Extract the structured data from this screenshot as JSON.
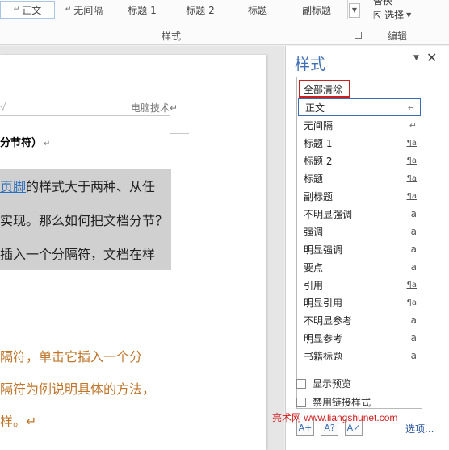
{
  "ribbon": {
    "gallery": [
      {
        "label": "正文",
        "marker": "↵",
        "selected": true
      },
      {
        "label": "无间隔",
        "marker": "↵",
        "selected": false
      },
      {
        "label": "标题 1",
        "marker": "",
        "selected": false
      },
      {
        "label": "标题 2",
        "marker": "",
        "selected": false
      },
      {
        "label": "标题",
        "marker": "",
        "selected": false
      },
      {
        "label": "副标题",
        "marker": "",
        "selected": false
      }
    ],
    "styles_group_label": "样式",
    "select_label": "选择",
    "partial_top_label": "替换",
    "editing_group_label": "编辑"
  },
  "document": {
    "header_left": "√",
    "header_right": "电脑技术↵",
    "heading": "分节符）",
    "para1": [
      {
        "pre": "",
        "link": "页脚",
        "post": "的样式大于两种、从任"
      },
      {
        "pre": "实现。那么如何把文档分节？",
        "link": "",
        "post": ""
      },
      {
        "pre": "插入一个分隔符，文档在样",
        "link": "",
        "post": ""
      }
    ],
    "para2": [
      "隔符，单击它插入一个分",
      "隔符为例说明具体的方法，",
      "样。↵"
    ]
  },
  "styles_pane": {
    "title": "样式",
    "items": [
      {
        "label": "全部清除",
        "icon": "",
        "type": "clear"
      },
      {
        "label": "正文",
        "icon": "↵",
        "type": "current"
      },
      {
        "label": "无间隔",
        "icon": "↵",
        "type": "normal"
      },
      {
        "label": "标题 1",
        "icon": "¶a",
        "type": "normal"
      },
      {
        "label": "标题 2",
        "icon": "¶a",
        "type": "normal"
      },
      {
        "label": "标题",
        "icon": "¶a",
        "type": "normal"
      },
      {
        "label": "副标题",
        "icon": "¶a",
        "type": "normal"
      },
      {
        "label": "不明显强调",
        "icon": "a",
        "type": "normal"
      },
      {
        "label": "强调",
        "icon": "a",
        "type": "normal"
      },
      {
        "label": "明显强调",
        "icon": "a",
        "type": "normal"
      },
      {
        "label": "要点",
        "icon": "a",
        "type": "normal"
      },
      {
        "label": "引用",
        "icon": "¶a",
        "type": "normal"
      },
      {
        "label": "明显引用",
        "icon": "¶a",
        "type": "normal"
      },
      {
        "label": "不明显参考",
        "icon": "a",
        "type": "normal"
      },
      {
        "label": "明显参考",
        "icon": "a",
        "type": "normal"
      },
      {
        "label": "书籍标题",
        "icon": "a",
        "type": "normal"
      }
    ],
    "show_preview_label": "显示预览",
    "disable_linked_label": "禁用链接样式",
    "options_label": "选项..."
  },
  "watermark": "亮术网 www.liangshunet.com",
  "colors": {
    "pane_title": "#3f6fb5",
    "clear_border": "#cc1f1f",
    "current_border": "#3a6db3",
    "link": "#2a6ebb",
    "orange_text": "#c0752a",
    "highlight": "#d0d0d0"
  }
}
